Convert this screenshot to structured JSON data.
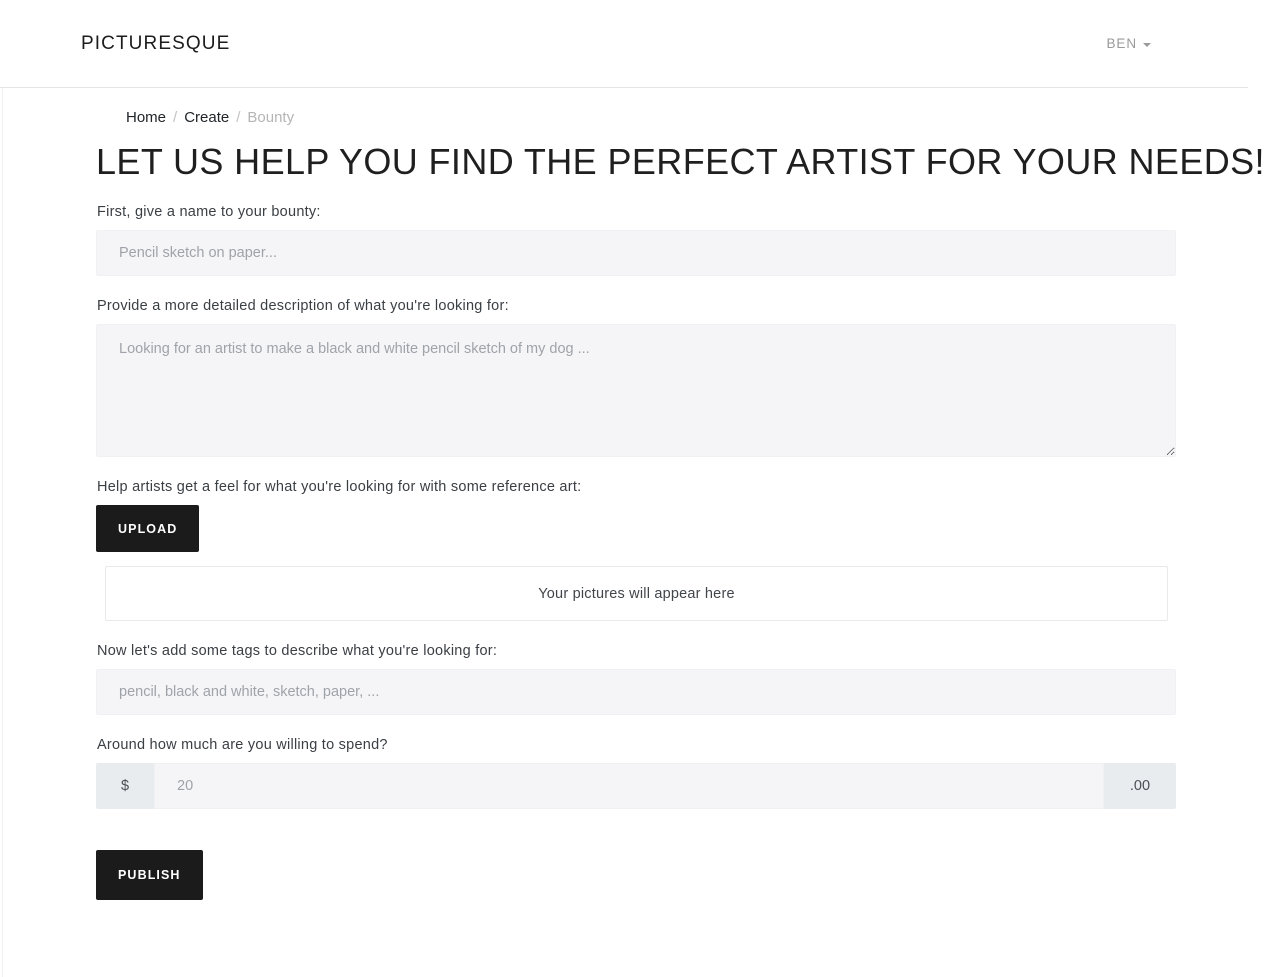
{
  "navbar": {
    "brand": "PICTURESQUE",
    "user_menu_label": "BEN",
    "caret_icon": "chevron-down-icon"
  },
  "breadcrumb": {
    "separator": "/",
    "items": [
      {
        "label": "Home",
        "active": false
      },
      {
        "label": "Create",
        "active": false
      },
      {
        "label": "Bounty",
        "active": true
      }
    ]
  },
  "main": {
    "title": "LET US HELP YOU FIND THE PERFECT ARTIST FOR YOUR NEEDS!",
    "name_field": {
      "label": "First, give a name to your bounty:",
      "value": "",
      "placeholder": "Pencil sketch on paper..."
    },
    "description_field": {
      "label": "Provide a more detailed description of what you're looking for:",
      "value": "",
      "placeholder": "Looking for an artist to make a black and white pencil sketch of my dog ..."
    },
    "reference_art": {
      "label": "Help artists get a feel for what you're looking for with some reference art:",
      "upload_button": "UPLOAD",
      "dropzone_text": "Your pictures will appear here"
    },
    "tags_field": {
      "label": "Now let's add some tags to describe what you're looking for:",
      "value": "",
      "placeholder": "pencil, black and white, sketch, paper, ..."
    },
    "price_field": {
      "label": "Around how much are you willing to spend?",
      "prefix": "$",
      "suffix": ".00",
      "value": "",
      "placeholder": "20"
    },
    "publish_button": "PUBLISH"
  },
  "colors": {
    "button_dark": "#1b1b1b",
    "input_background": "#f5f5f7",
    "addon_background": "#e9ecef",
    "muted_text": "#9fa3a9"
  }
}
